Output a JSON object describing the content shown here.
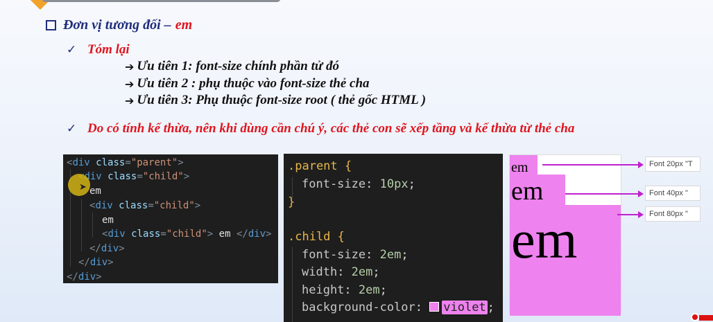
{
  "heading": {
    "prefix": "Đơn vị tương đối – ",
    "highlight": "em"
  },
  "summary": {
    "title": "Tóm lại",
    "priorities": [
      "Ưu tiên 1: font-size chính phần tử đó",
      "Ưu tiên 2 : phụ thuộc vào font-size thẻ cha",
      "Ưu tiên 3: Phụ thuộc font-size root ( thẻ gốc HTML )"
    ]
  },
  "note": "Do có tính kế thừa, nên khi dùng cần chú ý, các thẻ con sẽ xếp tầng và kế thừa từ thẻ cha",
  "html_code": {
    "tag_div": "div",
    "attr_class": "class",
    "parent_value": "\"parent\"",
    "child_value": "\"child\"",
    "text_em": "em"
  },
  "css_code": {
    "parent_selector": ".parent",
    "child_selector": ".child",
    "open_brace": "{",
    "close_brace": "}",
    "rules": [
      {
        "prop": "font-size",
        "value": "10px"
      },
      {
        "prop": "font-size",
        "value": "2em"
      },
      {
        "prop": "width",
        "value": "2em"
      },
      {
        "prop": "height",
        "value": "2em"
      },
      {
        "prop": "background-color",
        "value": "violet"
      }
    ]
  },
  "preview": {
    "text": "em",
    "labels": [
      "Font   20px \"T",
      "Font   40px \"",
      "Font   80px \""
    ]
  },
  "colors": {
    "accent": "#e0141e",
    "heading": "#1f2d7a",
    "violet": "#ee82ee",
    "arrow": "#c020d0"
  }
}
